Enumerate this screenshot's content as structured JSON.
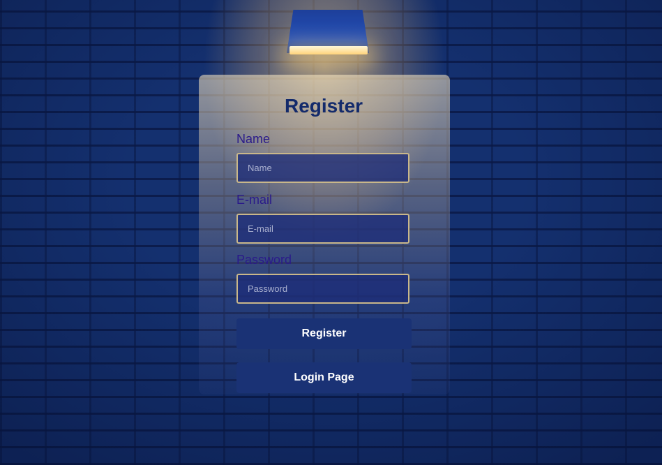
{
  "form": {
    "title": "Register",
    "fields": [
      {
        "label": "Name",
        "placeholder": "Name"
      },
      {
        "label": "E-mail",
        "placeholder": "E-mail"
      },
      {
        "label": "Password",
        "placeholder": "Password"
      }
    ],
    "register_button": "Register",
    "login_button": "Login Page"
  },
  "colors": {
    "wall": "#14306f",
    "title": "#132a6b",
    "label": "#2a1a8a",
    "button": "#1a3275",
    "input_border": "#c9b78a"
  },
  "icons": {
    "lamp": "wall-lamp-icon"
  }
}
